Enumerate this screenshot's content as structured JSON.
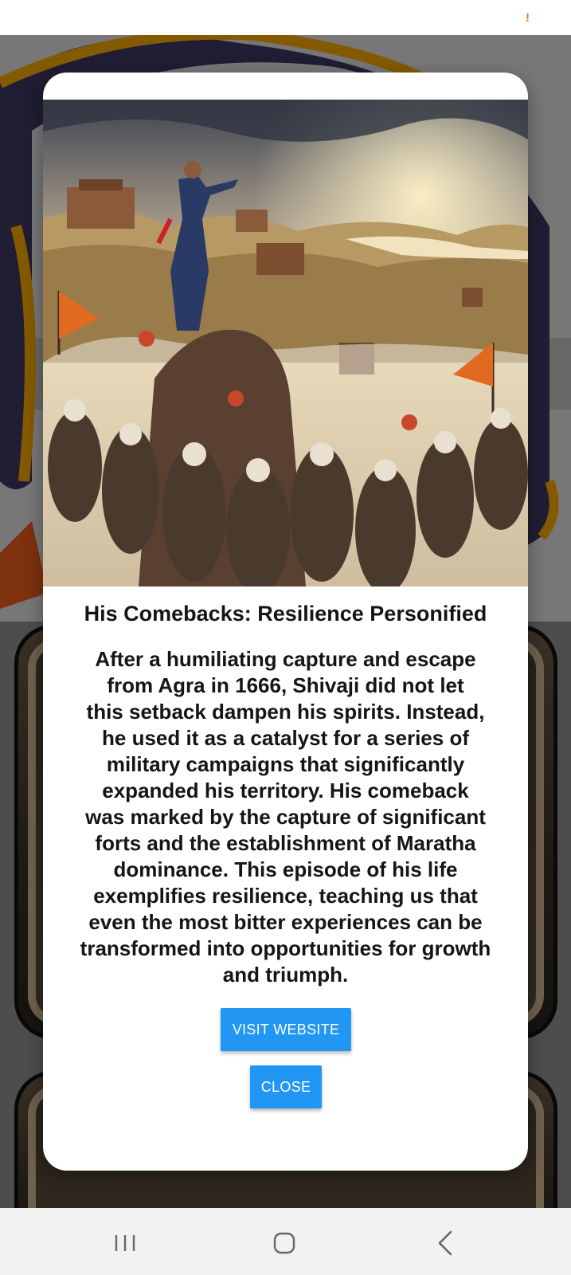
{
  "status_bar": {
    "alert_icon": "!"
  },
  "dialog": {
    "image": {
      "subject": "illustration of a warrior leader standing on a rock addressing kneeling soldiers with saffron flags, forts in the valley at sunset"
    },
    "title": "His Comebacks: Resilience Personified",
    "body": "  After a humiliating capture and escape\nfrom Agra in 1666, Shivaji did not let\nthis setback dampen his spirits. Instead,\nhe used it as a catalyst for a series of\nmilitary campaigns that significantly\nexpanded his territory. His comeback\nwas marked by the capture of significant\nforts and the establishment of Maratha\ndominance. This episode of his life\nexemplifies resilience, teaching us that\neven the most bitter experiences can be\ntransformed into opportunities for growth\nand triumph.",
    "buttons": {
      "visit": "VISIT WEBSITE",
      "close": "CLOSE"
    }
  },
  "nav_bar": {
    "icons": [
      "recent-apps-icon",
      "home-icon",
      "back-icon"
    ]
  },
  "colors": {
    "primary_button": "#2196f3",
    "dialog_background": "#ffffff",
    "alert": "#e07b2a",
    "scrim": "rgba(0,0,0,0.45)"
  }
}
